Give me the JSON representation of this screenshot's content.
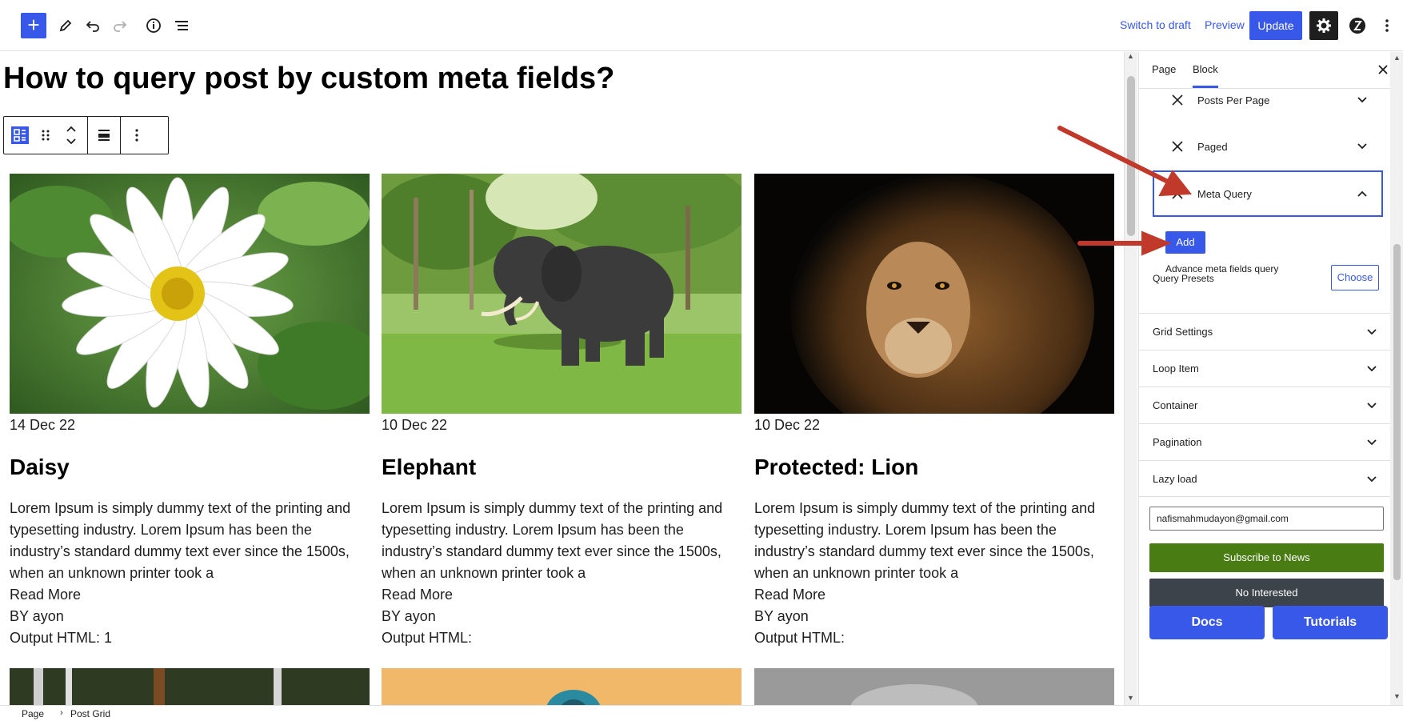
{
  "toolbar": {
    "switch_draft": "Switch to draft",
    "preview": "Preview",
    "update": "Update",
    "icons": [
      "plus-icon",
      "pencil-icon",
      "undo-icon",
      "redo-icon",
      "info-icon",
      "list-view-icon",
      "gear-icon",
      "plugin-icon",
      "kebab-icon"
    ]
  },
  "editor": {
    "title": "How to query post by custom meta fields?",
    "posts": [
      {
        "date": "14 Dec 22",
        "title": "Daisy",
        "excerpt": "Lorem Ipsum is simply dummy text of the printing and typesetting industry. Lorem Ipsum has been the industry’s standard dummy text ever since the 1500s, when an unknown printer took a",
        "read_more": "Read More",
        "author": "BY ayon",
        "output": "Output HTML: 1"
      },
      {
        "date": "10 Dec 22",
        "title": "Elephant",
        "excerpt": "Lorem Ipsum is simply dummy text of the printing and typesetting industry. Lorem Ipsum has been the industry’s standard dummy text ever since the 1500s, when an unknown printer took a",
        "read_more": "Read More",
        "author": "BY ayon",
        "output": "Output HTML:"
      },
      {
        "date": "10 Dec 22",
        "title": "Protected: Lion",
        "excerpt": "Lorem Ipsum is simply dummy text of the printing and typesetting industry. Lorem Ipsum has been the industry’s standard dummy text ever since the 1500s, when an unknown printer took a",
        "read_more": "Read More",
        "author": "BY ayon",
        "output": "Output HTML:"
      }
    ]
  },
  "sidebar": {
    "tabs": {
      "page": "Page",
      "block": "Block"
    },
    "query_items": [
      {
        "label": "Posts Per Page"
      },
      {
        "label": "Paged"
      },
      {
        "label": "Meta Query"
      }
    ],
    "add_label": "Add",
    "help_text": "Advance meta fields query",
    "presets_label": "Query Presets",
    "choose_label": "Choose",
    "panels": [
      {
        "label": "Grid Settings"
      },
      {
        "label": "Loop Item"
      },
      {
        "label": "Container"
      },
      {
        "label": "Pagination"
      },
      {
        "label": "Lazy load"
      }
    ],
    "email_value": "nafismahmudayon@gmail.com",
    "subscribe_label": "Subscribe to News",
    "no_interest_label": "No Interested",
    "docs_label": "Docs",
    "tutorials_label": "Tutorials"
  },
  "breadcrumb": {
    "items": [
      "Page",
      "Post Grid"
    ]
  },
  "colors": {
    "accent": "#3858e9",
    "subscribe": "#4a7c14",
    "annotation_arrow": "#c0392b"
  }
}
